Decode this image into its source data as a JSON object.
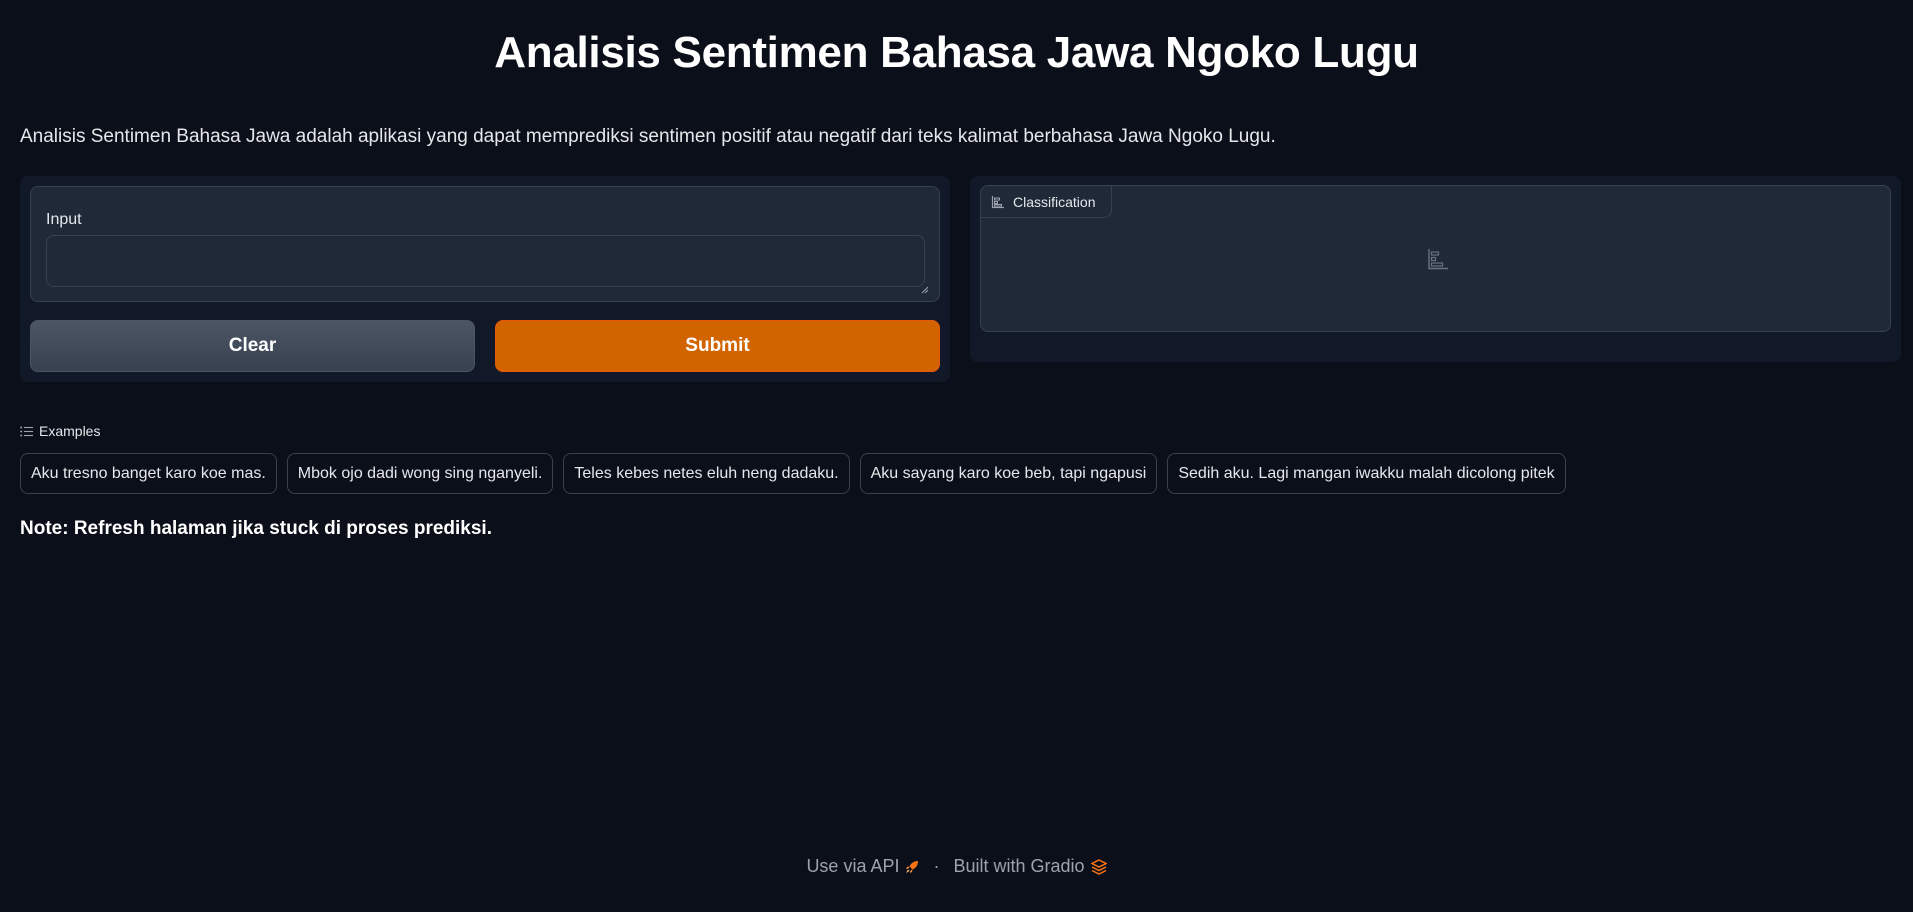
{
  "header": {
    "title": "Analisis Sentimen Bahasa Jawa Ngoko Lugu",
    "description": "Analisis Sentimen Bahasa Jawa adalah aplikasi yang dapat memprediksi sentimen positif atau negatif dari teks kalimat berbahasa Jawa Ngoko Lugu."
  },
  "input_panel": {
    "label": "Input",
    "value": "",
    "placeholder": "",
    "clear_label": "Clear",
    "submit_label": "Submit"
  },
  "output_panel": {
    "label": "Classification",
    "icon": "bar-chart-icon"
  },
  "examples": {
    "heading": "Examples",
    "items": [
      "Aku tresno banget karo koe mas.",
      "Mbok ojo dadi wong sing nganyeli.",
      "Teles kebes netes eluh neng dadaku.",
      "Aku sayang karo koe beb, tapi ngapusi",
      "Sedih aku. Lagi mangan iwakku malah dicolong pitek"
    ]
  },
  "note": "Note: Refresh halaman jika stuck di proses prediksi.",
  "footer": {
    "api_label": "Use via API",
    "separator": "·",
    "built_label": "Built with Gradio"
  },
  "colors": {
    "background": "#0b0f19",
    "panel": "#111827",
    "block": "#1f2937",
    "border": "#374151",
    "accent": "#d26400",
    "secondary_button": "#4b5563"
  }
}
